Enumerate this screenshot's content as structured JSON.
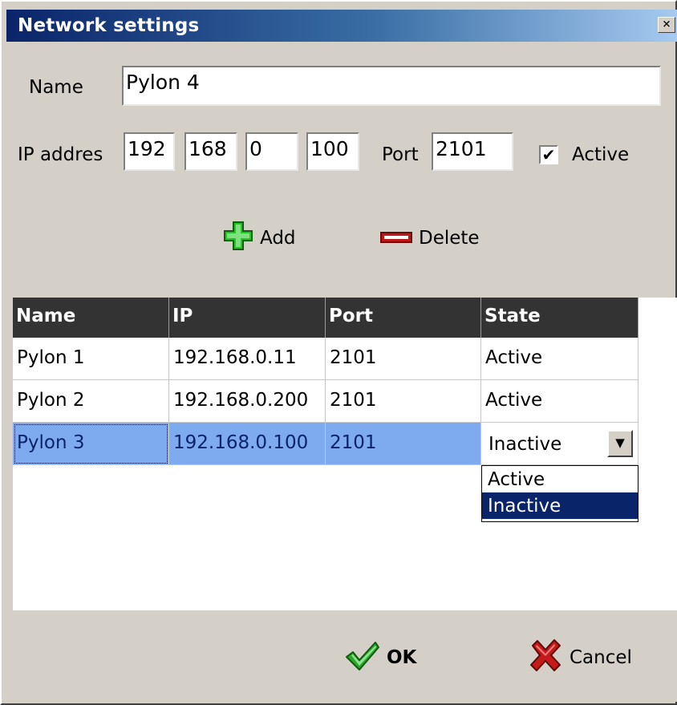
{
  "window": {
    "title": "Network settings",
    "close_glyph": "×"
  },
  "form": {
    "name_label": "Name",
    "name_value": "Pylon 4",
    "ip_label": "IP addres",
    "ip_octets": [
      "192",
      "168",
      "0",
      "100"
    ],
    "port_label": "Port",
    "port_value": "2101",
    "active_label": "Active",
    "active_checked": true,
    "check_glyph": "✔"
  },
  "toolbar": {
    "add_label": "Add",
    "delete_label": "Delete",
    "add_icon": "plus-icon",
    "delete_icon": "minus-icon",
    "add_color": "#24c424",
    "delete_color": "#c01818"
  },
  "table": {
    "columns": [
      "Name",
      "IP",
      "Port",
      "State"
    ],
    "rows": [
      {
        "name": "Pylon 1",
        "ip": "192.168.0.11",
        "port": "2101",
        "state": "Active"
      },
      {
        "name": "Pylon 2",
        "ip": "192.168.0.200",
        "port": "2101",
        "state": "Active"
      },
      {
        "name": "Pylon 3",
        "ip": "192.168.0.100",
        "port": "2101",
        "state": "Inactive"
      }
    ],
    "selected_row": 2
  },
  "state_editor": {
    "value": "Inactive",
    "arrow_glyph": "▼",
    "options": [
      "Active",
      "Inactive"
    ],
    "highlighted": "Inactive"
  },
  "footer": {
    "ok_label": "OK",
    "cancel_label": "Cancel",
    "ok_icon": "checkmark-icon",
    "cancel_icon": "x-cross-icon",
    "ok_color": "#2aa82a",
    "cancel_color": "#c41a1a"
  },
  "colors": {
    "titlebar_start": "#0a246a",
    "titlebar_end": "#a6caf0",
    "header_bg": "#333333",
    "selection_bg": "#7eaaf0",
    "dropdown_selection_bg": "#0a246a"
  }
}
